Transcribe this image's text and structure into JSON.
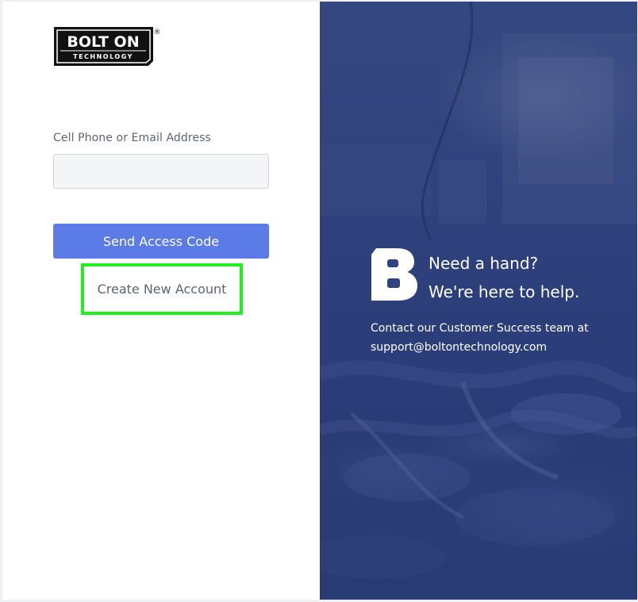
{
  "brand": {
    "logo_word": "BOLT ON",
    "logo_sub": "TECHNOLOGY",
    "logo_mark": "®"
  },
  "login": {
    "field_label": "Cell Phone or Email Address",
    "field_value": "",
    "field_placeholder": "",
    "send_button_label": "Send Access Code",
    "create_account_label": "Create New Account"
  },
  "help": {
    "line1": "Need a hand?",
    "line2": "We're here to help.",
    "body_line1": "Contact our Customer Success team at",
    "body_line2": "support@boltontechnology.com"
  },
  "colors": {
    "primary_button": "#5b7be7",
    "highlight_border": "#22ee22",
    "panel_blue": "#2f4380",
    "label_text": "#5c6474"
  },
  "icons": {
    "brand_logo": "bolt-on-technology-logo",
    "help_logo": "bolt-b-icon"
  }
}
